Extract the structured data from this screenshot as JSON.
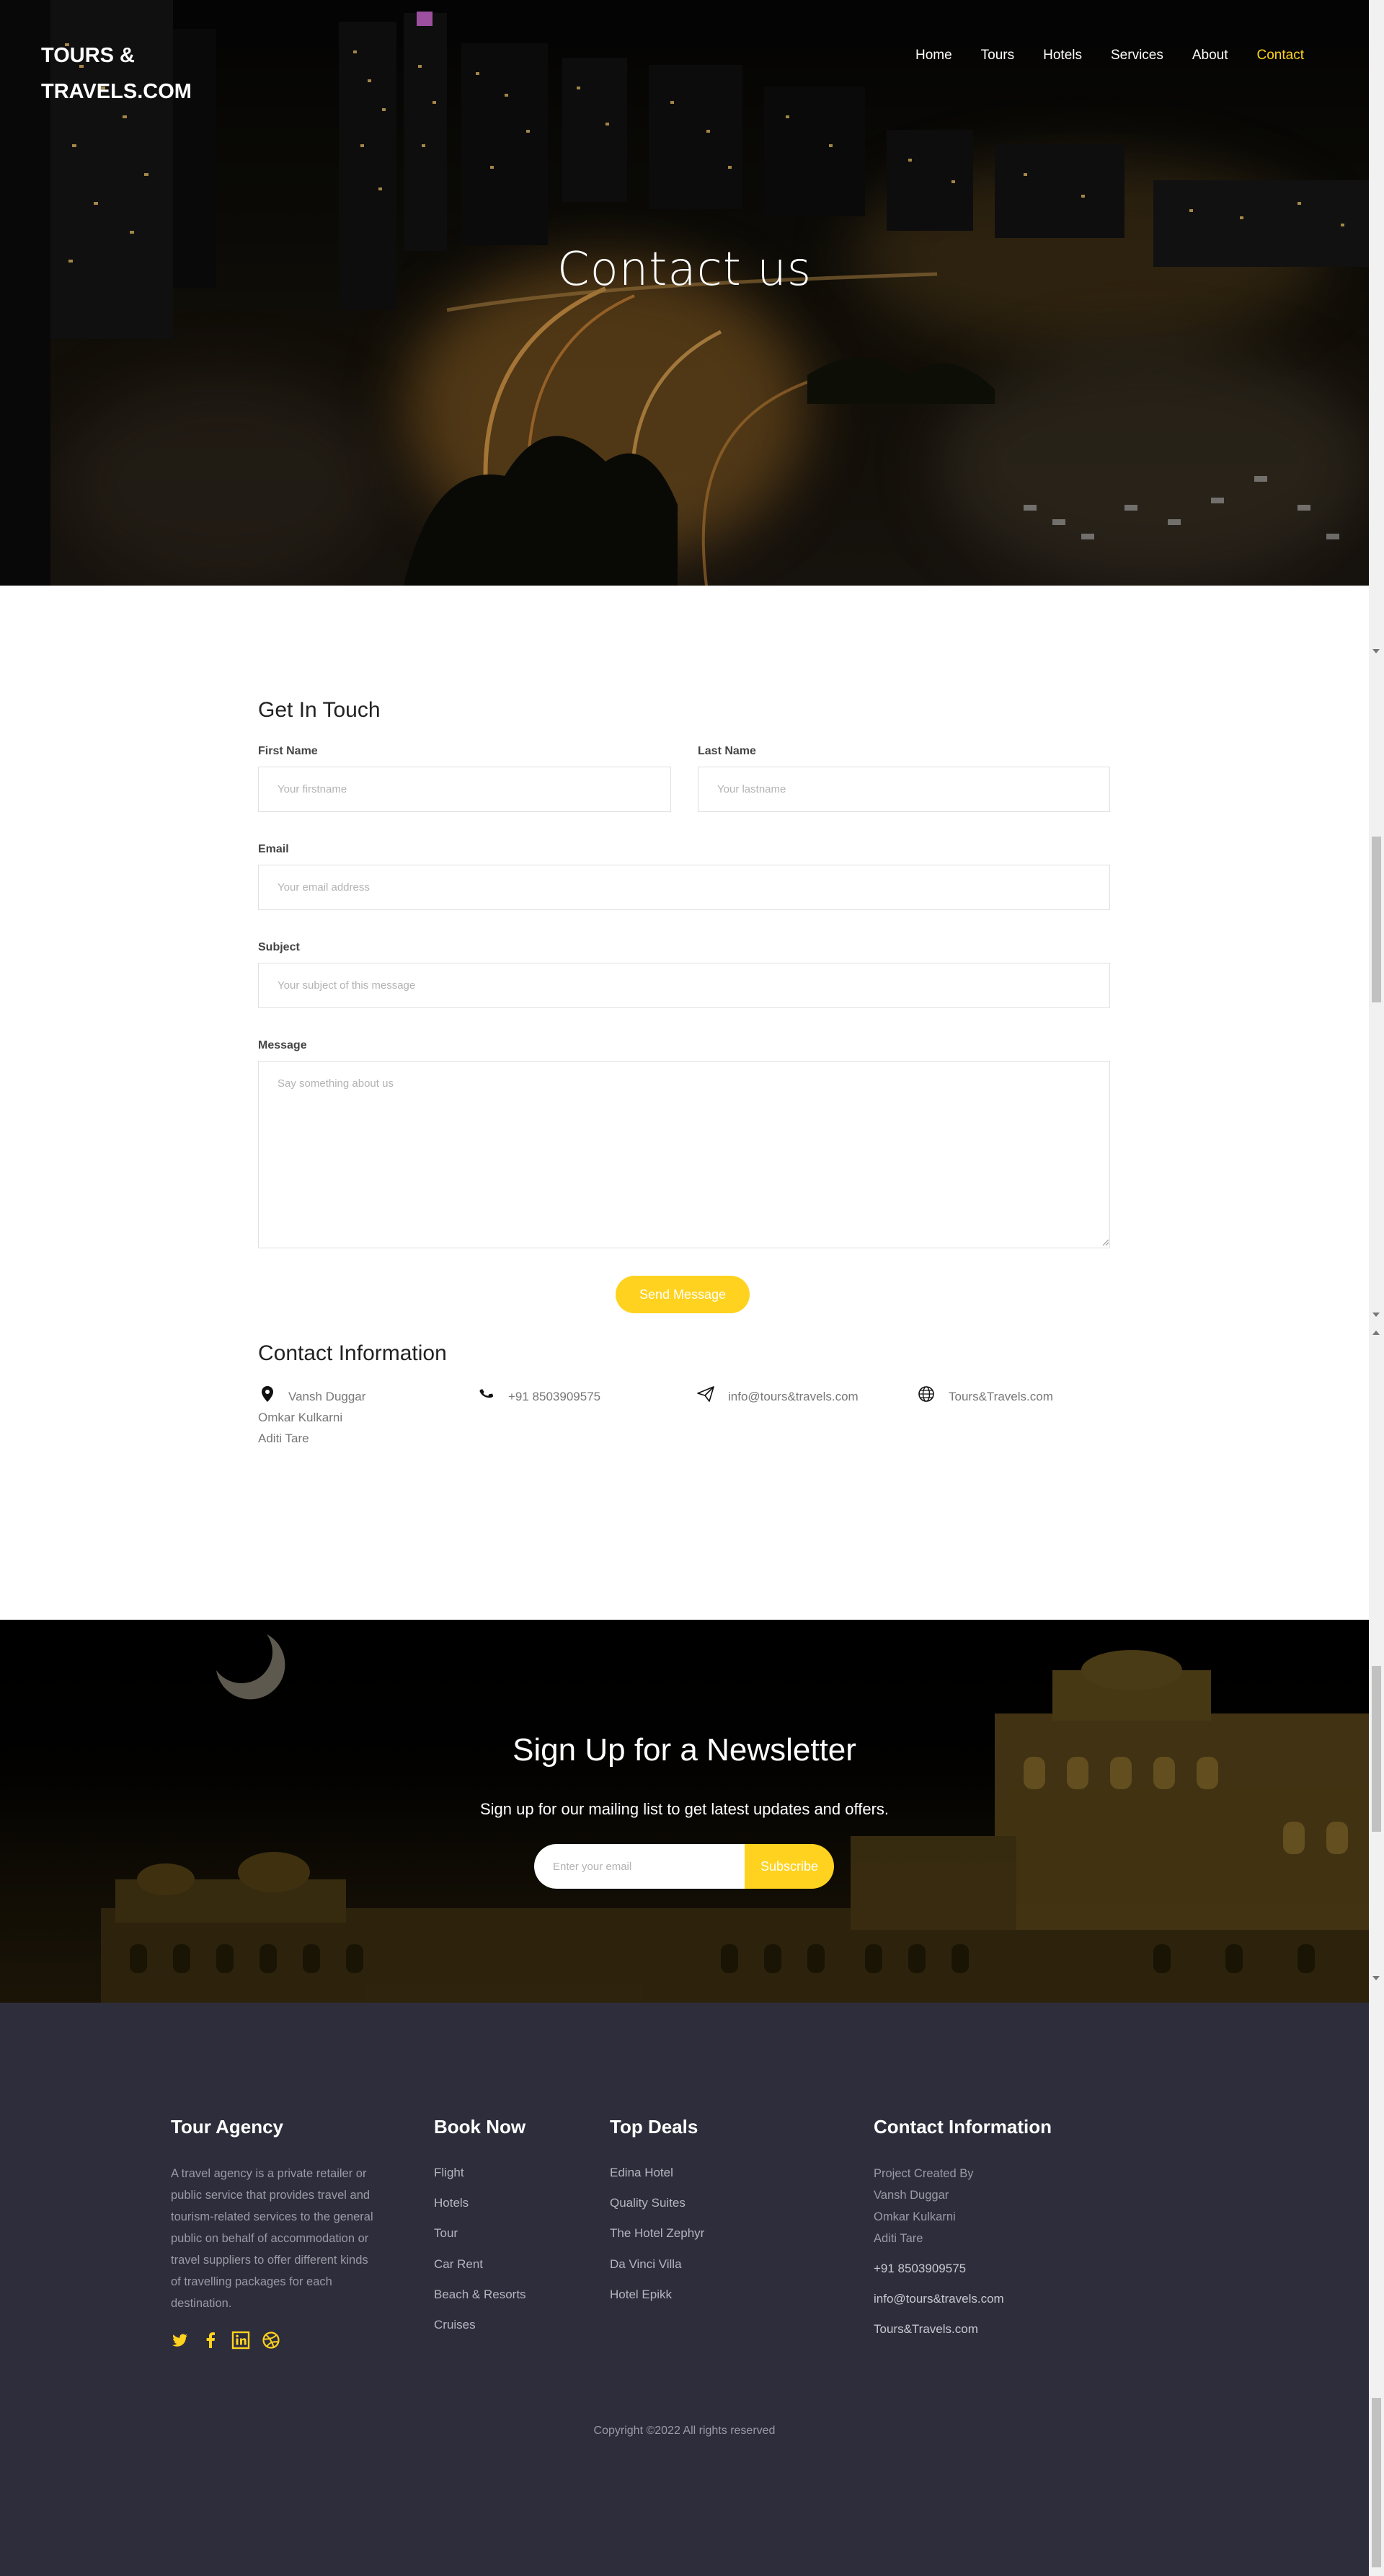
{
  "brand": {
    "logo_line1": "TOURS &",
    "logo_line2": "TRAVELS.COM"
  },
  "nav": {
    "items": [
      {
        "label": "Home"
      },
      {
        "label": "Tours"
      },
      {
        "label": "Hotels"
      },
      {
        "label": "Services"
      },
      {
        "label": "About"
      },
      {
        "label": "Contact"
      }
    ],
    "active": "Contact",
    "active_color": "#ffd21f"
  },
  "hero": {
    "title": "Contact us"
  },
  "form": {
    "heading": "Get In Touch",
    "first_name": {
      "label": "First Name",
      "placeholder": "Your firstname"
    },
    "last_name": {
      "label": "Last Name",
      "placeholder": "Your lastname"
    },
    "email": {
      "label": "Email",
      "placeholder": "Your email address"
    },
    "subject": {
      "label": "Subject",
      "placeholder": "Your subject of this message"
    },
    "message": {
      "label": "Message",
      "placeholder": "Say something about us"
    },
    "send_label": "Send Message"
  },
  "contact_info": {
    "heading": "Contact Information",
    "people": [
      "Vansh Duggar",
      "Omkar Kulkarni",
      "Aditi Tare"
    ],
    "phone": "+91 8503909575",
    "email": "info@tours&travels.com",
    "website": "Tours&Travels.com",
    "icons": [
      "map-pin-icon",
      "phone-icon",
      "paper-plane-icon",
      "globe-icon"
    ]
  },
  "newsletter": {
    "title": "Sign Up for a Newsletter",
    "subtitle": "Sign up for our mailing list to get latest updates and offers.",
    "placeholder": "Enter your email",
    "button": "Subscribe"
  },
  "footer": {
    "about": {
      "heading": "Tour Agency",
      "lines": [
        "A travel agency is a private retailer or",
        "public service that provides travel and",
        "tourism-related services to the general",
        "public on behalf of accommodation or",
        "travel suppliers to offer different kinds",
        "of travelling packages for each",
        "destination."
      ],
      "social": [
        "twitter-icon",
        "facebook-icon",
        "linkedin-icon",
        "dribbble-icon"
      ]
    },
    "book_now": {
      "heading": "Book Now",
      "links": [
        "Flight",
        "Hotels",
        "Tour",
        "Car Rent",
        "Beach & Resorts",
        "Cruises"
      ]
    },
    "top_deals": {
      "heading": "Top Deals",
      "links": [
        "Edina Hotel",
        "Quality Suites",
        "The Hotel Zephyr",
        "Da Vinci Villa",
        "Hotel Epikk"
      ]
    },
    "contact": {
      "heading": "Contact Information",
      "created_by": "Project Created By",
      "people": [
        "Vansh Duggar",
        "Omkar Kulkarni",
        "Aditi Tare"
      ],
      "phone": "+91 8503909575",
      "email": "info@tours&travels.com",
      "website": "Tours&Travels.com"
    },
    "copyright": "Copyright ©2022 All rights reserved"
  },
  "colors": {
    "accent": "#ffd21f",
    "footer_bg": "#2e2d3b",
    "muted_text": "#9a9aa6"
  }
}
